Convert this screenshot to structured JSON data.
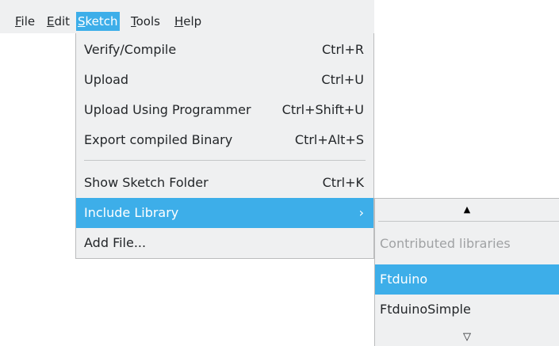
{
  "menubar": {
    "items": [
      {
        "label": "File",
        "mnemonic": "F",
        "rest": "ile"
      },
      {
        "label": "Edit",
        "mnemonic": "E",
        "rest": "dit"
      },
      {
        "label": "Sketch",
        "mnemonic": "S",
        "rest": "ketch",
        "active": true
      },
      {
        "label": "Tools",
        "mnemonic": "T",
        "rest": "ools"
      },
      {
        "label": "Help",
        "mnemonic": "H",
        "rest": "elp"
      }
    ]
  },
  "sketch_menu": {
    "items": [
      {
        "label": "Verify/Compile",
        "shortcut": "Ctrl+R"
      },
      {
        "label": "Upload",
        "shortcut": "Ctrl+U"
      },
      {
        "label": "Upload Using Programmer",
        "shortcut": "Ctrl+Shift+U"
      },
      {
        "label": "Export compiled Binary",
        "shortcut": "Ctrl+Alt+S"
      },
      {
        "label": "Show Sketch Folder",
        "shortcut": "Ctrl+K"
      },
      {
        "label": "Include Library",
        "submenu_arrow": "›",
        "highlighted": true
      },
      {
        "label": "Add File..."
      }
    ]
  },
  "library_submenu": {
    "scroll_up": "▲",
    "section_header": "Contributed libraries",
    "items": [
      {
        "label": "Ftduino",
        "highlighted": true
      },
      {
        "label": "FtduinoSimple"
      }
    ],
    "scroll_down": "▽"
  },
  "colors": {
    "menu_bg": "#eff0f1",
    "highlight": "#3daee9",
    "text": "#232629",
    "disabled_text": "#a0a2a4"
  }
}
